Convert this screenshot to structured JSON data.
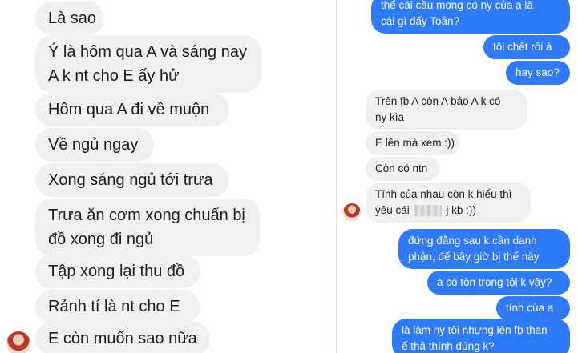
{
  "left_chat": {
    "messages": [
      {
        "lines": [
          "Là sao"
        ]
      },
      {
        "lines": [
          "Ý là hôm qua A và sáng nay",
          "A k nt cho E ấy hử"
        ]
      },
      {
        "lines": [
          "Hôm qua A đi về muộn"
        ]
      },
      {
        "lines": [
          "Về ngủ ngay"
        ]
      },
      {
        "lines": [
          "Xong sáng ngủ tới trưa"
        ]
      },
      {
        "lines": [
          "Trưa ăn cơm xong chuẩn bị",
          "đồ xong đi ngủ"
        ]
      },
      {
        "lines": [
          "Tập xong lại thu đồ"
        ]
      },
      {
        "lines": [
          "Rảnh tí là nt cho E"
        ]
      },
      {
        "lines": [
          "E còn muốn sao nữa"
        ]
      }
    ]
  },
  "right_chat": {
    "outgoing_top": [
      {
        "lines": [
          "thế cái cầu mong có ny của a là",
          "cái gì đấy Toản?"
        ]
      },
      {
        "lines": [
          "tôi chết rồi à"
        ]
      },
      {
        "lines": [
          "hay sao?"
        ]
      }
    ],
    "incoming": [
      {
        "lines": [
          "Trên fb A còn A bảo A k có",
          "ny kìa"
        ]
      },
      {
        "lines": [
          "E lên mà xem :))"
        ]
      },
      {
        "lines": [
          "Còn có ntn"
        ]
      },
      {
        "lines": [
          "Tính của nhau còn k hiểu thì",
          "yêu cái",
          "j kb :))"
        ]
      }
    ],
    "outgoing_bottom": [
      {
        "lines": [
          "đứng đằng sau k cần danh",
          "phận, để bây giờ bị thế này"
        ]
      },
      {
        "lines": [
          "a có tôn trọng tôi k vậy?"
        ]
      },
      {
        "lines": [
          "tính của a"
        ]
      },
      {
        "lines": [
          "là làm ny tôi nhưng lên fb than",
          "ế thả thính đúng k?"
        ]
      }
    ]
  },
  "colors": {
    "incoming_bubble": "#f0f0f0",
    "outgoing_bubble": "#2f7af8"
  }
}
